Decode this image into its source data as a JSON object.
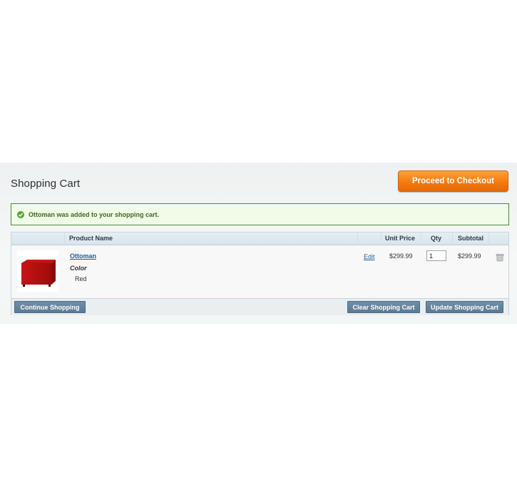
{
  "page": {
    "title": "Shopping Cart"
  },
  "actions": {
    "checkout_label": "Proceed to Checkout"
  },
  "message": {
    "text": "Ottoman was added to your shopping cart.",
    "status_color": "#58a532"
  },
  "table": {
    "headers": {
      "product_name": "Product Name",
      "unit_price": "Unit Price",
      "qty": "Qty",
      "subtotal": "Subtotal"
    },
    "rows": [
      {
        "image_icon": "red-ottoman-image",
        "name": "Ottoman",
        "option_label": "Color",
        "option_value": "Red",
        "edit_label": "Edit",
        "unit_price": "$299.99",
        "qty": "1",
        "subtotal": "$299.99",
        "remove_icon": "trash-icon"
      }
    ]
  },
  "footer": {
    "continue_label": "Continue Shopping",
    "clear_label": "Clear Shopping Cart",
    "update_label": "Update Shopping Cart"
  },
  "colors": {
    "checkout_accent": "#f47a10",
    "button_slate": "#5b7a94",
    "link": "#1e5e97"
  }
}
